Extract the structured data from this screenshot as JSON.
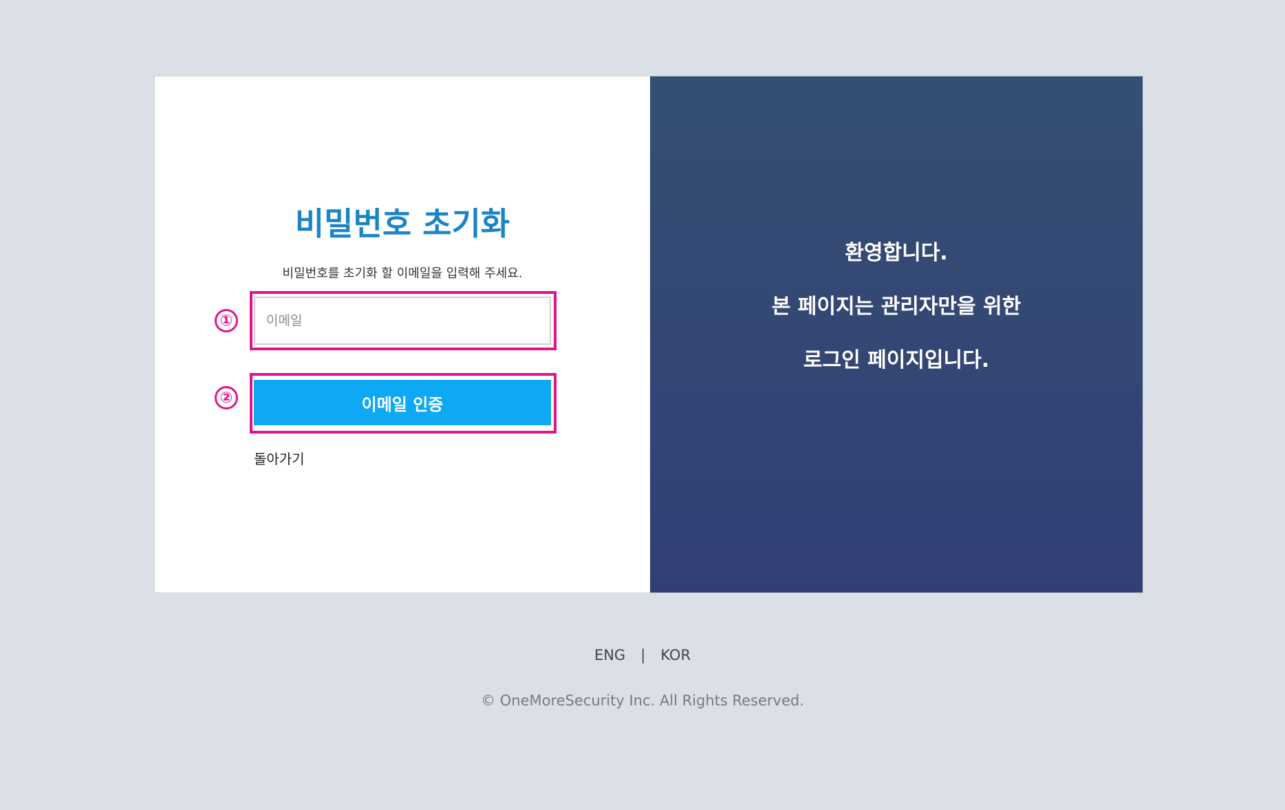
{
  "left": {
    "title": "비밀번호 초기화",
    "subtitle": "비밀번호를 초기화 할 이메일을 입력해 주세요.",
    "email_placeholder": "이메일",
    "email_value": "",
    "verify_button_label": "이메일 인증",
    "back_link_label": "돌아가기",
    "markers": [
      "①",
      "②"
    ]
  },
  "right": {
    "lines": [
      "환영합니다.",
      "본 페이지는 관리자만을 위한",
      "로그인 페이지입니다."
    ]
  },
  "footer": {
    "languages": [
      "ENG",
      "KOR"
    ],
    "separator": "|",
    "copyright": "© OneMoreSecurity Inc. All Rights Reserved."
  },
  "colors": {
    "accent": "#1a84c7",
    "button": "#0ea8f5",
    "panel_top": "#354f74",
    "panel_bottom": "#323f75",
    "highlight": "#e0138c",
    "background": "#dae0e6"
  }
}
